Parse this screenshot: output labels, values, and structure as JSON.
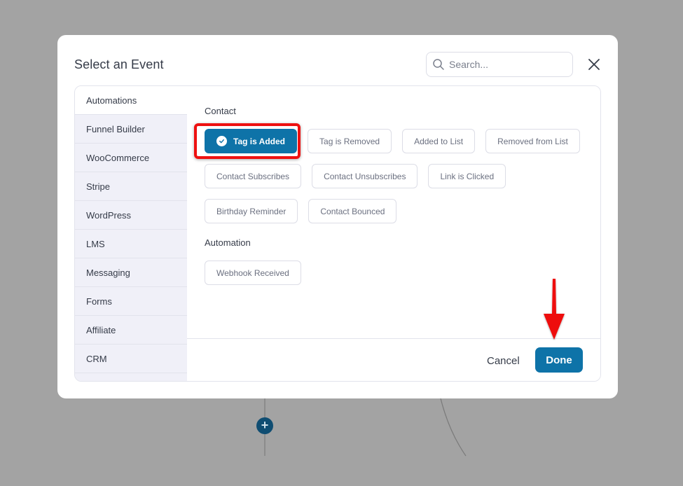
{
  "modal": {
    "title": "Select an Event",
    "search_placeholder": "Search...",
    "search_value": ""
  },
  "sidebar": {
    "items": [
      {
        "label": "Automations",
        "active": true
      },
      {
        "label": "Funnel Builder",
        "active": false
      },
      {
        "label": "WooCommerce",
        "active": false
      },
      {
        "label": "Stripe",
        "active": false
      },
      {
        "label": "WordPress",
        "active": false
      },
      {
        "label": "LMS",
        "active": false
      },
      {
        "label": "Messaging",
        "active": false
      },
      {
        "label": "Forms",
        "active": false
      },
      {
        "label": "Affiliate",
        "active": false
      },
      {
        "label": "CRM",
        "active": false
      }
    ]
  },
  "sections": [
    {
      "label": "Contact",
      "events": [
        {
          "label": "Tag is Added",
          "selected": true
        },
        {
          "label": "Tag is Removed",
          "selected": false
        },
        {
          "label": "Added to List",
          "selected": false
        },
        {
          "label": "Removed from List",
          "selected": false
        },
        {
          "label": "Contact Subscribes",
          "selected": false
        },
        {
          "label": "Contact Unsubscribes",
          "selected": false
        },
        {
          "label": "Link is Clicked",
          "selected": false
        },
        {
          "label": "Birthday Reminder",
          "selected": false
        },
        {
          "label": "Contact Bounced",
          "selected": false
        }
      ]
    },
    {
      "label": "Automation",
      "events": [
        {
          "label": "Webhook Received",
          "selected": false
        }
      ]
    }
  ],
  "footer": {
    "cancel_label": "Cancel",
    "done_label": "Done"
  },
  "background": {
    "add_step_icon": "plus-icon"
  },
  "colors": {
    "accent": "#0e73a8",
    "annotation": "#ee1111",
    "overlay": "#a3a3a3"
  }
}
